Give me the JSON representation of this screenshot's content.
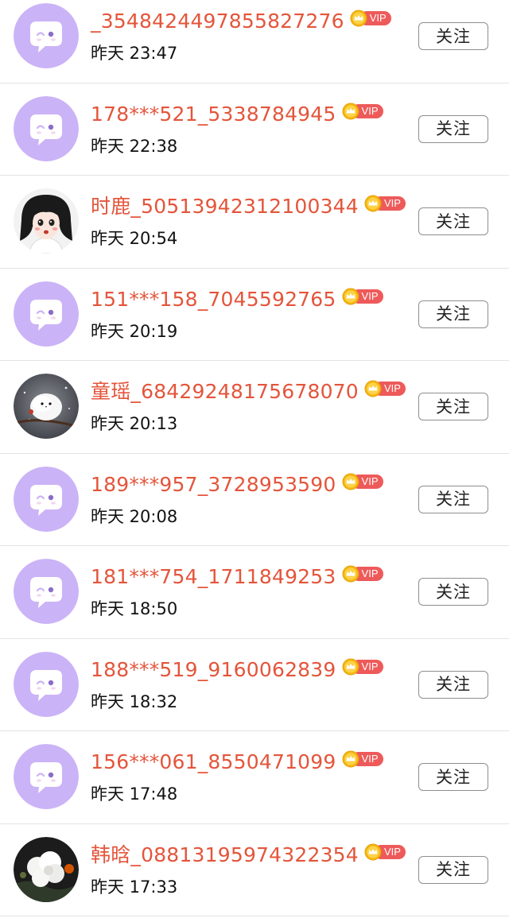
{
  "follow_label": "关注",
  "vip_label": "VIP",
  "colors": {
    "name": "#e4553b",
    "vip_badge": "#ee5a5a",
    "default_avatar_bg": "#cbb3f7",
    "divider": "#e3e3e3"
  },
  "users": [
    {
      "name": "_3548424497855827276",
      "time": "昨天 23:47",
      "avatar": "default-chat-avatar-icon"
    },
    {
      "name": "178***521_5338784945",
      "time": "昨天 22:38",
      "avatar": "default-chat-avatar-icon"
    },
    {
      "name": "时鹿_50513942312100344",
      "time": "昨天 20:54",
      "avatar": "cartoon-girl-avatar"
    },
    {
      "name": "151***158_7045592765",
      "time": "昨天 20:19",
      "avatar": "default-chat-avatar-icon"
    },
    {
      "name": "童瑶_68429248175678070",
      "time": "昨天 20:13",
      "avatar": "white-bird-photo-avatar"
    },
    {
      "name": "189***957_3728953590",
      "time": "昨天 20:08",
      "avatar": "default-chat-avatar-icon"
    },
    {
      "name": "181***754_1711849253",
      "time": "昨天 18:50",
      "avatar": "default-chat-avatar-icon"
    },
    {
      "name": "188***519_9160062839",
      "time": "昨天 18:32",
      "avatar": "default-chat-avatar-icon"
    },
    {
      "name": "156***061_8550471099",
      "time": "昨天 17:48",
      "avatar": "default-chat-avatar-icon"
    },
    {
      "name": "韩晗_08813195974322354",
      "time": "昨天 17:33",
      "avatar": "white-flower-photo-avatar"
    }
  ]
}
